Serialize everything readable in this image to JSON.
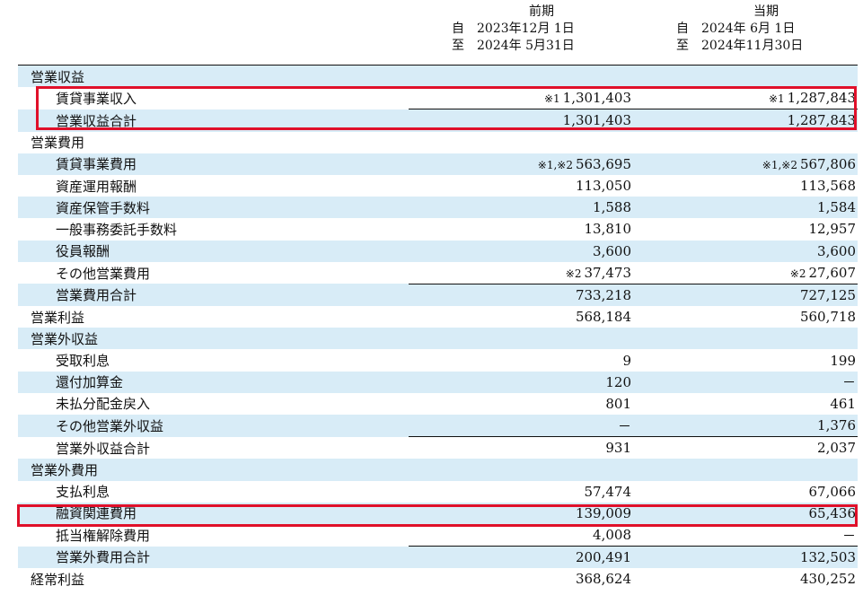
{
  "header": {
    "prev": {
      "period": "前期",
      "from_label": "自",
      "from_date": "2023年12月 1日",
      "to_label": "至",
      "to_date": "2024年 5月31日"
    },
    "curr": {
      "period": "当期",
      "from_label": "自",
      "from_date": "2024年 6月 1日",
      "to_label": "至",
      "to_date": "2024年11月30日"
    }
  },
  "rows": [
    {
      "label": "営業収益",
      "level": 0,
      "prev": "",
      "curr": "",
      "shade": true
    },
    {
      "label": "賃貸事業収入",
      "level": 1,
      "prev_note": "※1",
      "prev": "1,301,403",
      "curr_note": "※1",
      "curr": "1,287,843",
      "shade": false
    },
    {
      "label": "営業収益合計",
      "level": 2,
      "prev": "1,301,403",
      "curr": "1,287,843",
      "shade": true,
      "sum": true
    },
    {
      "label": "営業費用",
      "level": 0,
      "prev": "",
      "curr": "",
      "shade": false
    },
    {
      "label": "賃貸事業費用",
      "level": 1,
      "prev_note": "※1,※2",
      "prev": "563,695",
      "curr_note": "※1,※2",
      "curr": "567,806",
      "shade": true
    },
    {
      "label": "資産運用報酬",
      "level": 1,
      "prev": "113,050",
      "curr": "113,568",
      "shade": false
    },
    {
      "label": "資産保管手数料",
      "level": 1,
      "prev": "1,588",
      "curr": "1,584",
      "shade": true
    },
    {
      "label": "一般事務委託手数料",
      "level": 1,
      "prev": "13,810",
      "curr": "12,957",
      "shade": false
    },
    {
      "label": "役員報酬",
      "level": 1,
      "prev": "3,600",
      "curr": "3,600",
      "shade": true
    },
    {
      "label": "その他営業費用",
      "level": 1,
      "prev_note": "※2",
      "prev": "37,473",
      "curr_note": "※2",
      "curr": "27,607",
      "shade": false
    },
    {
      "label": "営業費用合計",
      "level": 2,
      "prev": "733,218",
      "curr": "727,125",
      "shade": true,
      "sum": true
    },
    {
      "label": "営業利益",
      "level": 0,
      "prev": "568,184",
      "curr": "560,718",
      "shade": false
    },
    {
      "label": "営業外収益",
      "level": 0,
      "prev": "",
      "curr": "",
      "shade": true
    },
    {
      "label": "受取利息",
      "level": 1,
      "prev": "9",
      "curr": "199",
      "shade": false
    },
    {
      "label": "還付加算金",
      "level": 1,
      "prev": "120",
      "curr": "－",
      "shade": true
    },
    {
      "label": "未払分配金戻入",
      "level": 1,
      "prev": "801",
      "curr": "461",
      "shade": false
    },
    {
      "label": "その他営業外収益",
      "level": 1,
      "prev": "－",
      "curr": "1,376",
      "shade": true
    },
    {
      "label": "営業外収益合計",
      "level": 2,
      "prev": "931",
      "curr": "2,037",
      "shade": false,
      "sum": true
    },
    {
      "label": "営業外費用",
      "level": 0,
      "prev": "",
      "curr": "",
      "shade": true
    },
    {
      "label": "支払利息",
      "level": 1,
      "prev": "57,474",
      "curr": "67,066",
      "shade": false
    },
    {
      "label": "融資関連費用",
      "level": 1,
      "prev": "139,009",
      "curr": "65,436",
      "shade": true
    },
    {
      "label": "抵当権解除費用",
      "level": 1,
      "prev": "4,008",
      "curr": "－",
      "shade": false
    },
    {
      "label": "営業外費用合計",
      "level": 2,
      "prev": "200,491",
      "curr": "132,503",
      "shade": true,
      "sum": true
    },
    {
      "label": "経常利益",
      "level": 0,
      "prev": "368,624",
      "curr": "430,252",
      "shade": false
    }
  ],
  "colors": {
    "shade": "#d8ecf7",
    "highlight": "#e0102a"
  }
}
